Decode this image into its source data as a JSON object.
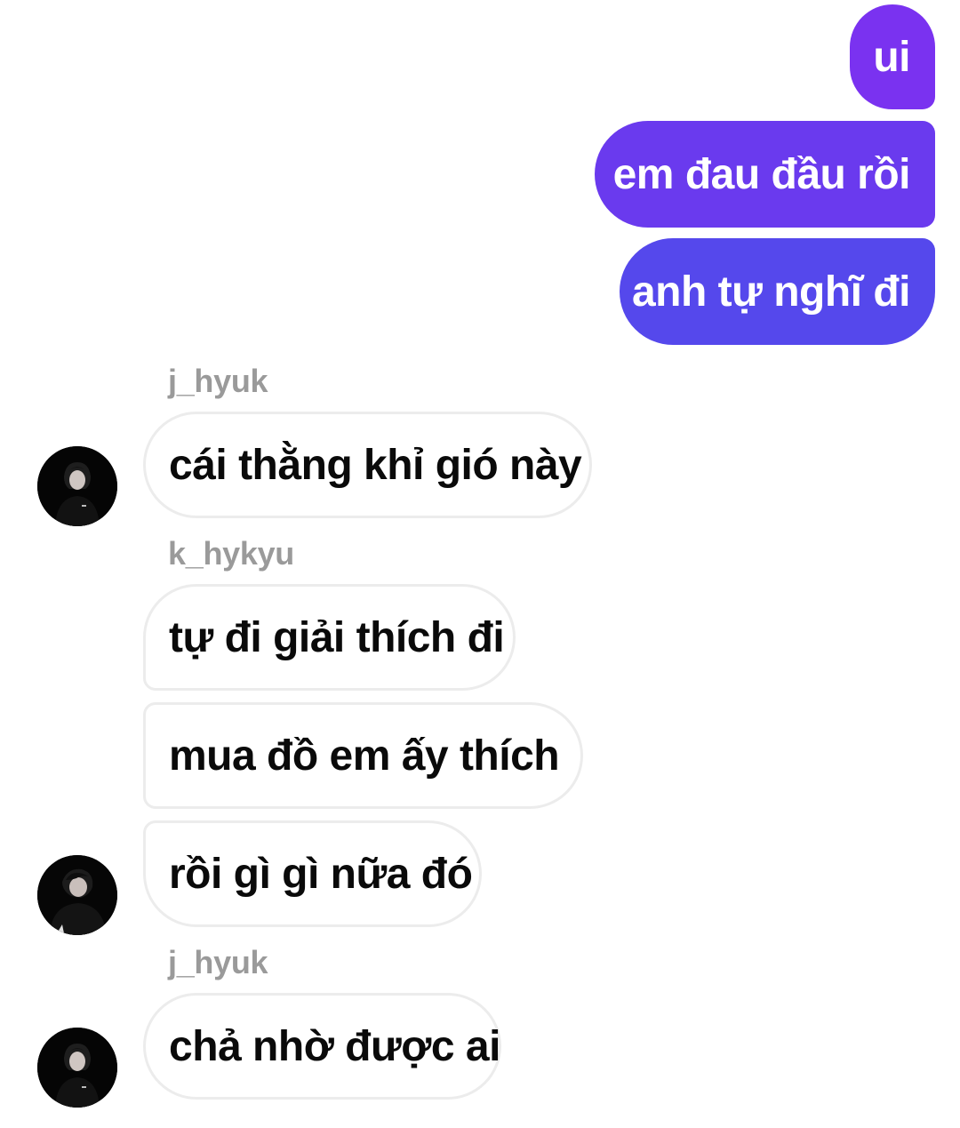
{
  "colors": {
    "outgoing_top": "#7a32f0",
    "outgoing_bottom": "#5548ec",
    "incoming_bg": "#ffffff",
    "incoming_border": "#ececec",
    "sender_name": "#9a9a9a"
  },
  "outgoing": [
    {
      "text": "ui"
    },
    {
      "text": "em đau đầu rồi"
    },
    {
      "text": "anh tự nghĩ đi"
    }
  ],
  "groups": [
    {
      "sender": "j_hyuk",
      "messages": [
        {
          "text": "cái thằng khỉ gió này"
        }
      ],
      "avatar": "profile-photo-icon"
    },
    {
      "sender": "k_hykyu",
      "messages": [
        {
          "text": "tự đi giải thích đi"
        },
        {
          "text": "mua đồ em ấy thích"
        },
        {
          "text": "rồi gì gì nữa đó"
        }
      ],
      "avatar": "profile-photo-icon"
    },
    {
      "sender": "j_hyuk",
      "messages": [
        {
          "text": "chả nhờ được ai"
        }
      ],
      "avatar": "profile-photo-icon"
    }
  ]
}
